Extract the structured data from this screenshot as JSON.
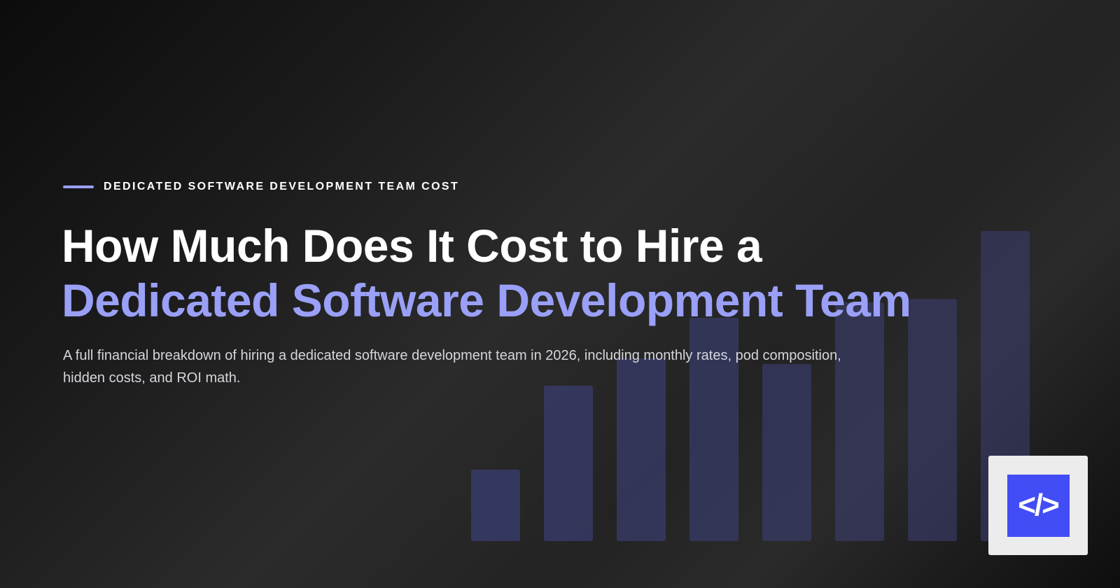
{
  "eyebrow": {
    "text": "DEDICATED SOFTWARE DEVELOPMENT TEAM COST"
  },
  "headline": {
    "line1": "How Much Does It Cost to Hire a",
    "line2": "Dedicated Software Development Team"
  },
  "subtitle": "A full financial breakdown of hiring a dedicated software development team in 2026, including monthly rates, pod composition, hidden costs, and ROI math.",
  "logo": {
    "icon": "code-brackets-icon",
    "glyph": "</>"
  },
  "decorative_bars": {
    "relative_heights": [
      0.23,
      0.5,
      0.59,
      0.72,
      0.57,
      0.77,
      0.78,
      1.0
    ]
  },
  "colors": {
    "accent": "#9aa0f7",
    "logo_blue": "#434df5",
    "bar_fill": "#3a3d6e"
  }
}
